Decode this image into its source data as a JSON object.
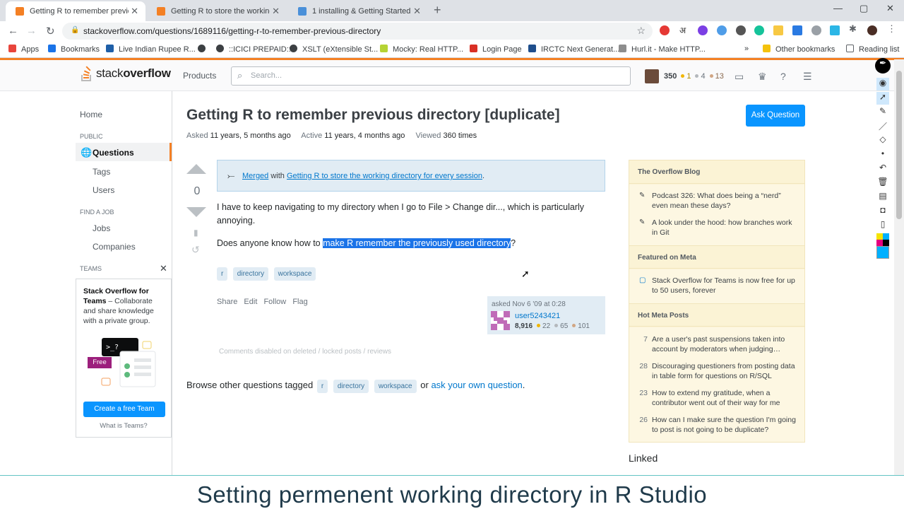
{
  "browser": {
    "tabs": [
      {
        "title": "Getting R to remember previous"
      },
      {
        "title": "Getting R to store the working di"
      },
      {
        "title": "1 installing & Getting Started wit"
      }
    ],
    "url": "stackoverflow.com/questions/1689116/getting-r-to-remember-previous-directory",
    "bookmarks": [
      "Apps",
      "Bookmarks",
      "Live Indian Rupee R...",
      "::ICICI PREPAID::",
      "XSLT (eXtensible St...",
      "Mocky: Real HTTP...",
      "Login Page",
      "IRCTC Next Generat...",
      "Hurl.it - Make HTTP...",
      "»",
      "Other bookmarks",
      "Reading list"
    ]
  },
  "so_header": {
    "logo_light": "stack",
    "logo_bold": "overflow",
    "products": "Products",
    "search_placeholder": "Search...",
    "rep": "350",
    "gold": "1",
    "silver": "4",
    "bronze": "13"
  },
  "leftnav": {
    "home": "Home",
    "public": "PUBLIC",
    "questions": "Questions",
    "tags": "Tags",
    "users": "Users",
    "find_job": "FIND A JOB",
    "jobs": "Jobs",
    "companies": "Companies",
    "teams": "TEAMS",
    "teams_title": "Stack Overflow for Teams",
    "teams_desc": " – Collaborate and share knowledge with a private group.",
    "free_badge": "Free",
    "create_btn": "Create a free Team",
    "what_is": "What is Teams?"
  },
  "question": {
    "title": "Getting R to remember previous directory [duplicate]",
    "asked_label": "Asked",
    "asked_value": "11 years, 5 months ago",
    "active_label": "Active",
    "active_value": "11 years, 4 months ago",
    "viewed_label": "Viewed",
    "viewed_value": "360 times",
    "ask_button": "Ask Question",
    "votes": "0",
    "merged_link": "Merged",
    "merged_with": " with ",
    "merged_target": "Getting R to store the working directory for every session",
    "merged_end": ".",
    "para1": "I have to keep navigating to my directory when I go to File > Change dir..., which is particularly annoying.",
    "para2_pre": "Does anyone know how to ",
    "para2_highlight": "make R remember the previously used directory",
    "para2_post": "?",
    "tags": [
      "r",
      "directory",
      "workspace"
    ],
    "menu": [
      "Share",
      "Edit",
      "Follow",
      "Flag"
    ],
    "asked_card": "asked Nov 6 '09 at 0:28",
    "user_name": "user5243421",
    "user_rep": "8,916",
    "user_gold": "22",
    "user_silver": "65",
    "user_bronze": "101",
    "comments_disabled": "Comments disabled on deleted / locked posts / reviews",
    "browse_pre": "Browse other questions tagged",
    "browse_or": "or",
    "browse_link": "ask your own question",
    "browse_end": "."
  },
  "sidebar": {
    "blog_head": "The Overflow Blog",
    "blog_items": [
      "Podcast 326: What does being a “nerd” even mean these days?",
      "A look under the hood: how branches work in Git"
    ],
    "meta_head": "Featured on Meta",
    "meta_items": [
      "Stack Overflow for Teams is now free for up to 50 users, forever"
    ],
    "hot_head": "Hot Meta Posts",
    "hot_items": [
      {
        "count": "7",
        "text": "Are a user's past suspensions taken into account by moderators when judging…"
      },
      {
        "count": "28",
        "text": "Discouraging questioners from posting data in table form for questions on R/SQL"
      },
      {
        "count": "23",
        "text": "How to extend my gratitude, when a contributor went out of their way for me"
      },
      {
        "count": "26",
        "text": "How can I make sure the question I'm going to post is not going to be duplicate?"
      }
    ],
    "linked": "Linked"
  },
  "caption": "Setting permenent working directory in R Studio",
  "colors": {
    "accent": "#f48024",
    "link": "#0077cc",
    "button": "#0a95ff",
    "highlight": "#1a73e8"
  }
}
